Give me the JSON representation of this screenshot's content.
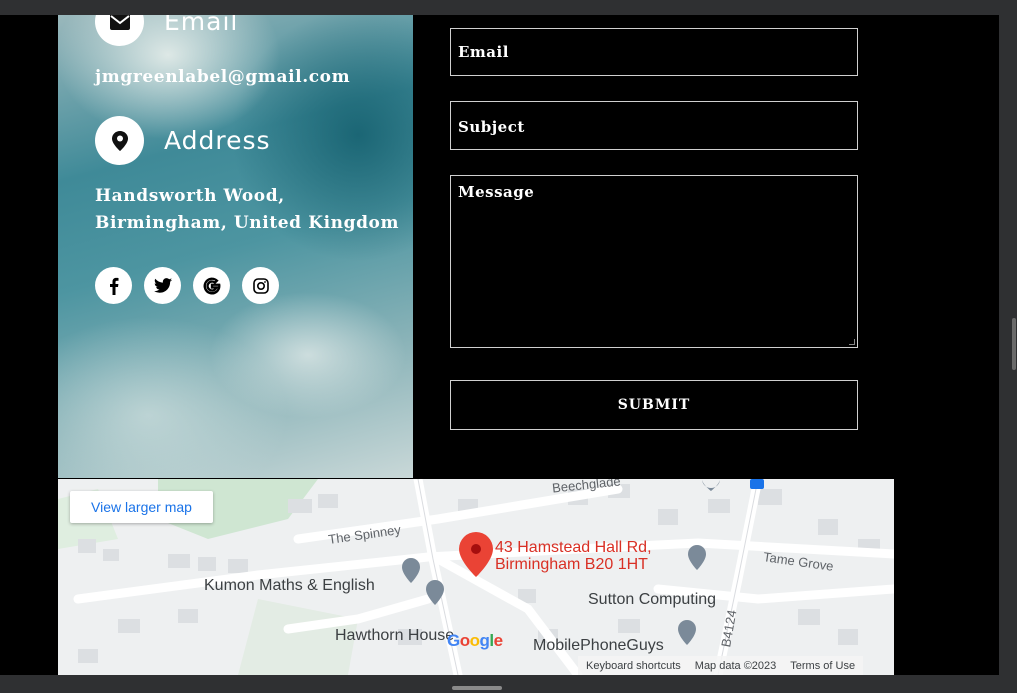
{
  "contact": {
    "email_title": "Email",
    "email_value": "jmgreenlabel@gmail.com",
    "address_title": "Address",
    "address_line1": "Handsworth Wood,",
    "address_line2": "Birmingham, United Kingdom",
    "socials": [
      "facebook-icon",
      "twitter-icon",
      "google-icon",
      "instagram-icon"
    ]
  },
  "form": {
    "email_placeholder": "Email",
    "subject_placeholder": "Subject",
    "message_placeholder": "Message",
    "submit_label": "SUBMIT"
  },
  "map": {
    "view_larger": "View larger map",
    "address_line1": "43 Hamstead Hall Rd,",
    "address_line2": "Birmingham B20 1HT",
    "poi_kumon": "Kumon Maths & English",
    "poi_hawthorn": "Hawthorn House",
    "poi_sutton": "Sutton Computing",
    "poi_mobile": "MobilePhoneGuys",
    "street_spinney": "The Spinney",
    "street_tame": "Tame Grove",
    "street_beech": "Beechglade",
    "road_b4124": "B4124",
    "google_logo": "Google",
    "keyboard": "Keyboard shortcuts",
    "mapdata": "Map data ©2023",
    "terms": "Terms of Use"
  },
  "colors": {
    "pin": "#ea4335",
    "link": "#1a73e8",
    "poi_pin": "#7b8a99"
  }
}
